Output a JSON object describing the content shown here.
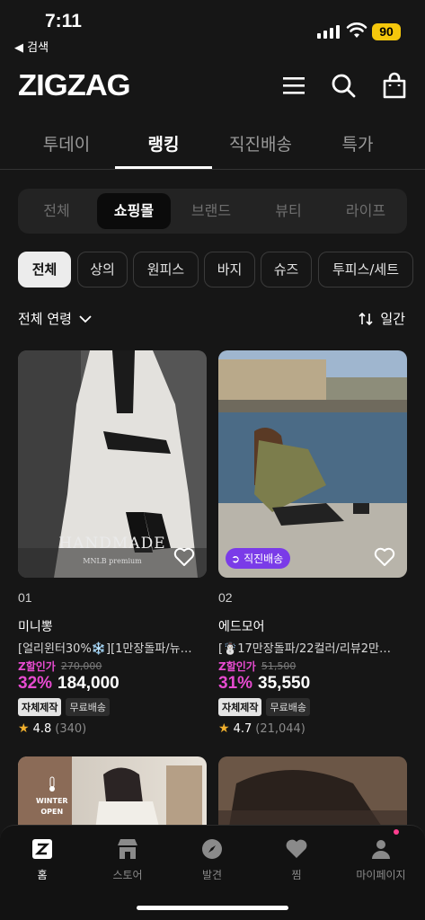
{
  "status_bar": {
    "time": "7:11",
    "back_label": "◀ 검색",
    "battery": "90"
  },
  "header": {
    "logo": "ZIGZAG"
  },
  "main_tabs": [
    {
      "label": "투데이",
      "active": false
    },
    {
      "label": "랭킹",
      "active": true
    },
    {
      "label": "직진배송",
      "active": false
    },
    {
      "label": "특가",
      "active": false
    }
  ],
  "segments": [
    {
      "label": "전체",
      "active": false
    },
    {
      "label": "쇼핑몰",
      "active": true
    },
    {
      "label": "브랜드",
      "active": false
    },
    {
      "label": "뷰티",
      "active": false
    },
    {
      "label": "라이프",
      "active": false
    }
  ],
  "chips": [
    {
      "label": "전체",
      "active": true
    },
    {
      "label": "상의",
      "active": false
    },
    {
      "label": "원피스",
      "active": false
    },
    {
      "label": "바지",
      "active": false
    },
    {
      "label": "슈즈",
      "active": false
    },
    {
      "label": "투피스/세트",
      "active": false
    }
  ],
  "filters": {
    "age": "전체 연령",
    "sort": "일간"
  },
  "products": [
    {
      "rank": "01",
      "shop": "미니뽕",
      "name": "[얼리윈터30%❄️][1만장돌파/뉴…",
      "z_label": "Z할인가",
      "original_price": "270,000",
      "discount": "32%",
      "price": "184,000",
      "badges": [
        "자체제작",
        "무료배송"
      ],
      "rating": "4.8",
      "reviews": "(340)",
      "watermark": "HANDMADE",
      "watermark_sub": "MNLB premium"
    },
    {
      "rank": "02",
      "shop": "에드모어",
      "name": "[☃️17만장돌파/22컬러/리뷰2만…",
      "z_label": "Z할인가",
      "original_price": "51,500",
      "discount": "31%",
      "price": "35,550",
      "badges": [
        "자체제작",
        "무료배송"
      ],
      "rating": "4.7",
      "reviews": "(21,044)",
      "direct_badge": "직진배송"
    }
  ],
  "lower_card": {
    "winter_label_1": "WINTER",
    "winter_label_2": "OPEN"
  },
  "bottom_nav": [
    {
      "label": "홈",
      "icon": "home-z-icon",
      "active": true
    },
    {
      "label": "스토어",
      "icon": "store-icon",
      "active": false
    },
    {
      "label": "발견",
      "icon": "compass-icon",
      "active": false
    },
    {
      "label": "찜",
      "icon": "heart-icon",
      "active": false
    },
    {
      "label": "마이페이지",
      "icon": "person-icon",
      "active": false
    }
  ],
  "colors": {
    "accent_pink": "#e74bd0",
    "direct_purple": "#7a3be8",
    "battery_yellow": "#f5c70c"
  }
}
